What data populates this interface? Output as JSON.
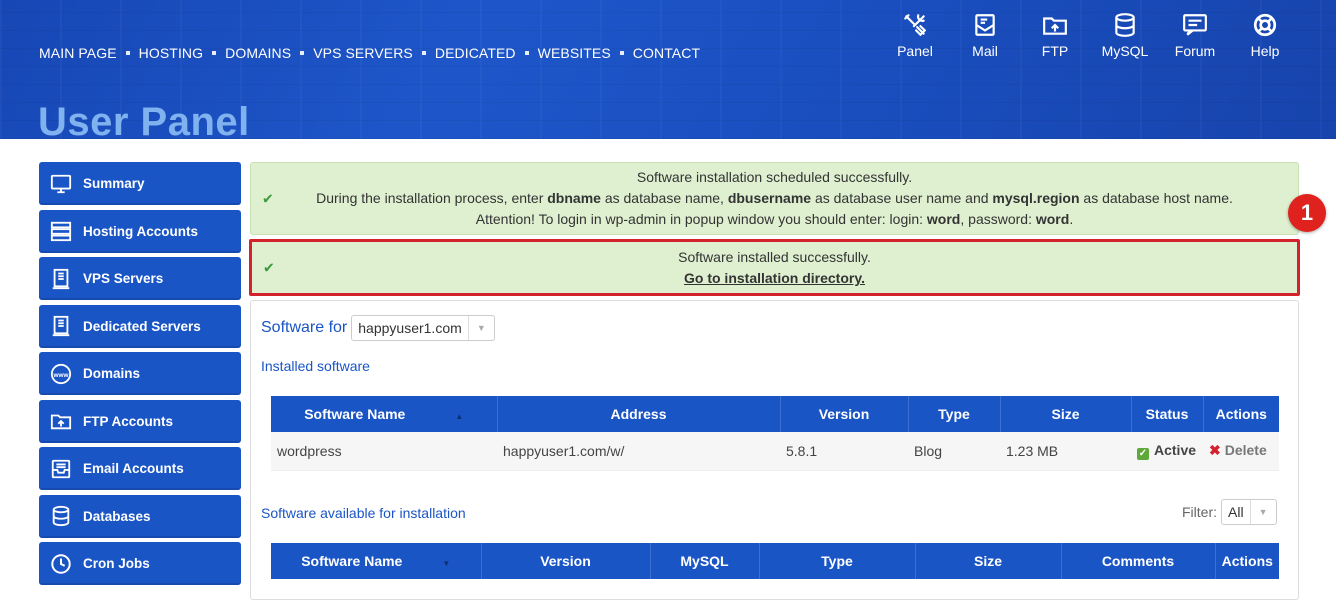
{
  "nav": [
    "MAIN PAGE",
    "HOSTING",
    "DOMAINS",
    "VPS SERVERS",
    "DEDICATED",
    "WEBSITES",
    "CONTACT"
  ],
  "tools": [
    {
      "label": "Panel",
      "icon": "tools-icon"
    },
    {
      "label": "Mail",
      "icon": "mail-icon"
    },
    {
      "label": "FTP",
      "icon": "ftp-folder-icon"
    },
    {
      "label": "MySQL",
      "icon": "database-icon"
    },
    {
      "label": "Forum",
      "icon": "forum-icon"
    },
    {
      "label": "Help",
      "icon": "lifebuoy-icon"
    }
  ],
  "page_title": "User Panel",
  "sidebar": [
    {
      "label": "Summary",
      "icon": "monitor-icon"
    },
    {
      "label": "Hosting Accounts",
      "icon": "server-icon"
    },
    {
      "label": "VPS Servers",
      "icon": "tower-icon"
    },
    {
      "label": "Dedicated Servers",
      "icon": "tower-icon"
    },
    {
      "label": "Domains",
      "icon": "www-globe-icon"
    },
    {
      "label": "FTP Accounts",
      "icon": "ftp-folder-icon"
    },
    {
      "label": "Email Accounts",
      "icon": "inbox-icon"
    },
    {
      "label": "Databases",
      "icon": "database-icon"
    },
    {
      "label": "Cron Jobs",
      "icon": "clock-icon"
    }
  ],
  "alert1": {
    "line1": "Software installation scheduled successfully.",
    "line2_a": "During the installation process, enter ",
    "line2_b": "dbname",
    "line2_c": " as database name, ",
    "line2_d": "dbusername",
    "line2_e": " as database user name and ",
    "line2_f": "mysql.region",
    "line2_g": " as database host name.",
    "line3_a": "Attention! To login in wp-admin in popup window you should enter: login: ",
    "line3_b": "word",
    "line3_c": ", password: ",
    "line3_d": "word",
    "line3_e": "."
  },
  "alert2": {
    "line1": "Software installed successfully.",
    "link": "Go to installation directory."
  },
  "badge": "1",
  "software_for": {
    "label": "Software for",
    "selected": "happyuser1.com"
  },
  "installed": {
    "title": "Installed software",
    "headers": [
      "Software Name",
      "Address",
      "Version",
      "Type",
      "Size",
      "Status",
      "Actions"
    ],
    "rows": [
      {
        "name": "wordpress",
        "address": "happyuser1.com/w/",
        "version": "5.8.1",
        "type": "Blog",
        "size": "1.23 MB",
        "status": "Active",
        "action": "Delete"
      }
    ]
  },
  "available": {
    "title": "Software available for installation",
    "filter_label": "Filter:",
    "filter_value": "All",
    "headers": [
      "Software Name",
      "Version",
      "MySQL",
      "Type",
      "Size",
      "Comments",
      "Actions"
    ]
  },
  "colors": {
    "primary": "#1a55c6",
    "success_bg": "#dff0d0",
    "highlight": "#d4222c"
  }
}
